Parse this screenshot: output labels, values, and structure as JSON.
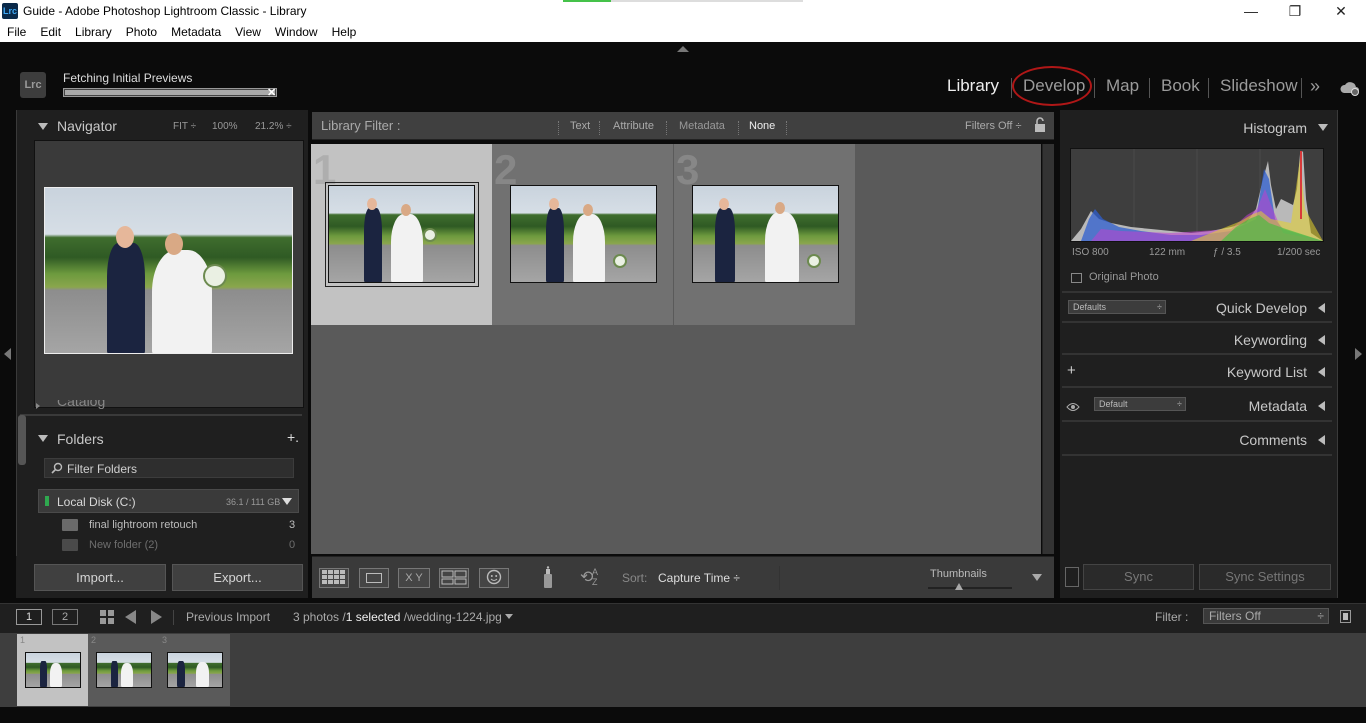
{
  "window": {
    "title": "Guide - Adobe Photoshop Lightroom Classic - Library",
    "app_badge": "Lrc",
    "minimize": "—",
    "restore": "❐",
    "close": "✕"
  },
  "menu": [
    "File",
    "Edit",
    "Library",
    "Photo",
    "Metadata",
    "View",
    "Window",
    "Help"
  ],
  "identity": {
    "logo": "Lrc",
    "status": "Fetching Initial Previews",
    "progress": 1.0,
    "cancel": "✕"
  },
  "modules": {
    "library": "Library",
    "develop": "Develop",
    "map": "Map",
    "book": "Book",
    "slideshow": "Slideshow",
    "more": "»",
    "active": "Library"
  },
  "navigator": {
    "title": "Navigator",
    "fit": "FIT ÷",
    "zoom100": "100%",
    "zoom212": "21.2% ÷"
  },
  "catalog": {
    "title": "Catalog"
  },
  "folders": {
    "title": "Folders",
    "add": "+.",
    "filter_placeholder": "Filter Folders",
    "volume": "Local Disk (C:)",
    "volume_size": "36.1 / 111 GB",
    "items": [
      {
        "name": "final lightroom retouch",
        "count": "3"
      },
      {
        "name": "New folder (2)",
        "count": "0"
      }
    ]
  },
  "left_buttons": {
    "import": "Import...",
    "export": "Export..."
  },
  "library_filter": {
    "label": "Library Filter :",
    "text": "Text",
    "attribute": "Attribute",
    "metadata": "Metadata",
    "none": "None",
    "filters_off": "Filters Off ÷"
  },
  "grid": {
    "cells": [
      {
        "num": "1",
        "selected": true
      },
      {
        "num": "2",
        "selected": false
      },
      {
        "num": "3",
        "selected": false
      }
    ]
  },
  "toolbar": {
    "sort_label": "Sort:",
    "sort_value": "Capture Time ÷",
    "thumbnails": "Thumbnails",
    "xy": "X Y",
    "az": "A Z"
  },
  "histogram": {
    "title": "Histogram",
    "iso": "ISO 800",
    "focal": "122 mm",
    "aperture": "ƒ / 3.5",
    "shutter": "1/200 sec",
    "original_photo": "Original Photo"
  },
  "right_panels": {
    "quick_develop": "Quick Develop",
    "qd_preset": "Defaults",
    "keywording": "Keywording",
    "keyword_list": "Keyword List",
    "keyword_add": "+",
    "metadata": "Metadata",
    "metadata_preset": "Default",
    "comments": "Comments"
  },
  "right_buttons": {
    "sync": "Sync",
    "sync_settings": "Sync Settings"
  },
  "filmstrip_bar": {
    "view1": "1",
    "view2": "2",
    "source": "Previous Import",
    "count": "3 photos /",
    "selected": "1 selected",
    "file": "/wedding-1224.jpg",
    "filter_label": "Filter :",
    "filter_value": "Filters Off"
  },
  "filmstrip": [
    {
      "num": "1",
      "selected": true
    },
    {
      "num": "2",
      "selected": false
    },
    {
      "num": "3",
      "selected": false
    }
  ],
  "colors": {
    "accent_red": "#b01717",
    "panel_bg": "#1f1f1f",
    "grid_bg": "#5a5a5a"
  }
}
